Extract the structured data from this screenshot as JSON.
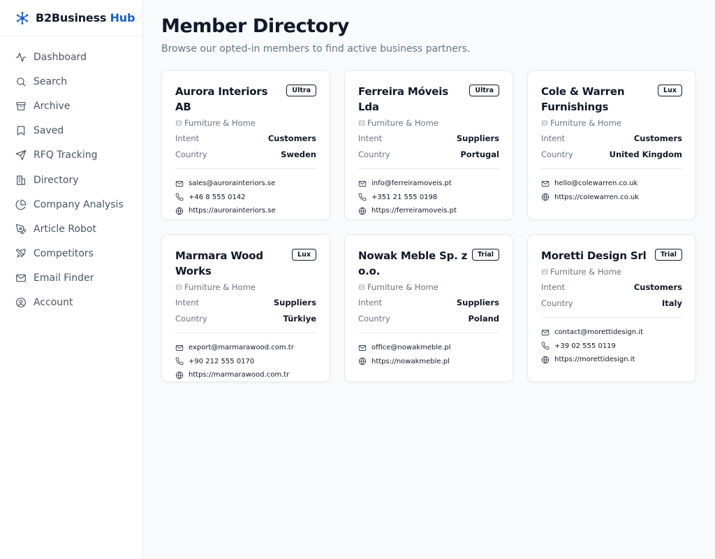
{
  "brand": {
    "name": "B2Business",
    "accent": "Hub",
    "accent_color": "#1f5fbf"
  },
  "nav": [
    {
      "label": "Dashboard",
      "icon": "activity-icon"
    },
    {
      "label": "Search",
      "icon": "search-icon"
    },
    {
      "label": "Archive",
      "icon": "archive-icon"
    },
    {
      "label": "Saved",
      "icon": "bookmark-icon"
    },
    {
      "label": "RFQ Tracking",
      "icon": "send-icon"
    },
    {
      "label": "Directory",
      "icon": "building-icon"
    },
    {
      "label": "Company Analysis",
      "icon": "pie-chart-icon"
    },
    {
      "label": "Article Robot",
      "icon": "pen-tool-icon"
    },
    {
      "label": "Competitors",
      "icon": "swords-icon"
    },
    {
      "label": "Email Finder",
      "icon": "mail-icon"
    },
    {
      "label": "Account",
      "icon": "user-circle-icon"
    }
  ],
  "page": {
    "title": "Member Directory",
    "subtitle": "Browse our opted-in members to find active business partners."
  },
  "labels": {
    "intent": "Intent",
    "country": "Country"
  },
  "members": [
    {
      "name": "Aurora Interiors AB",
      "badge": "Ultra",
      "category": "Furniture & Home",
      "intent": "Customers",
      "country": "Sweden",
      "email": "sales@aurorainteriors.se",
      "phone": "+46 8 555 0142",
      "website": "https://aurorainteriors.se"
    },
    {
      "name": "Ferreira Móveis Lda",
      "badge": "Ultra",
      "category": "Furniture & Home",
      "intent": "Suppliers",
      "country": "Portugal",
      "email": "info@ferreiramoveis.pt",
      "phone": "+351 21 555 0198",
      "website": "https://ferreiramoveis.pt"
    },
    {
      "name": "Cole & Warren Furnishings",
      "badge": "Lux",
      "category": "Furniture & Home",
      "intent": "Customers",
      "country": "United Kingdom",
      "email": "hello@colewarren.co.uk",
      "phone": "",
      "website": "https://colewarren.co.uk"
    },
    {
      "name": "Marmara Wood Works",
      "badge": "Lux",
      "category": "Furniture & Home",
      "intent": "Suppliers",
      "country": "Türkiye",
      "email": "export@marmarawood.com.tr",
      "phone": "+90 212 555 0170",
      "website": "https://marmarawood.com.tr"
    },
    {
      "name": "Nowak Meble Sp. z o.o.",
      "badge": "Trial",
      "category": "Furniture & Home",
      "intent": "Suppliers",
      "country": "Poland",
      "email": "office@nowakmeble.pl",
      "phone": "",
      "website": "https://nowakmeble.pl"
    },
    {
      "name": "Moretti Design Srl",
      "badge": "Trial",
      "category": "Furniture & Home",
      "intent": "Customers",
      "country": "Italy",
      "email": "contact@morettidesign.it",
      "phone": "+39 02 555 0119",
      "website": "https://morettidesign.it"
    }
  ]
}
